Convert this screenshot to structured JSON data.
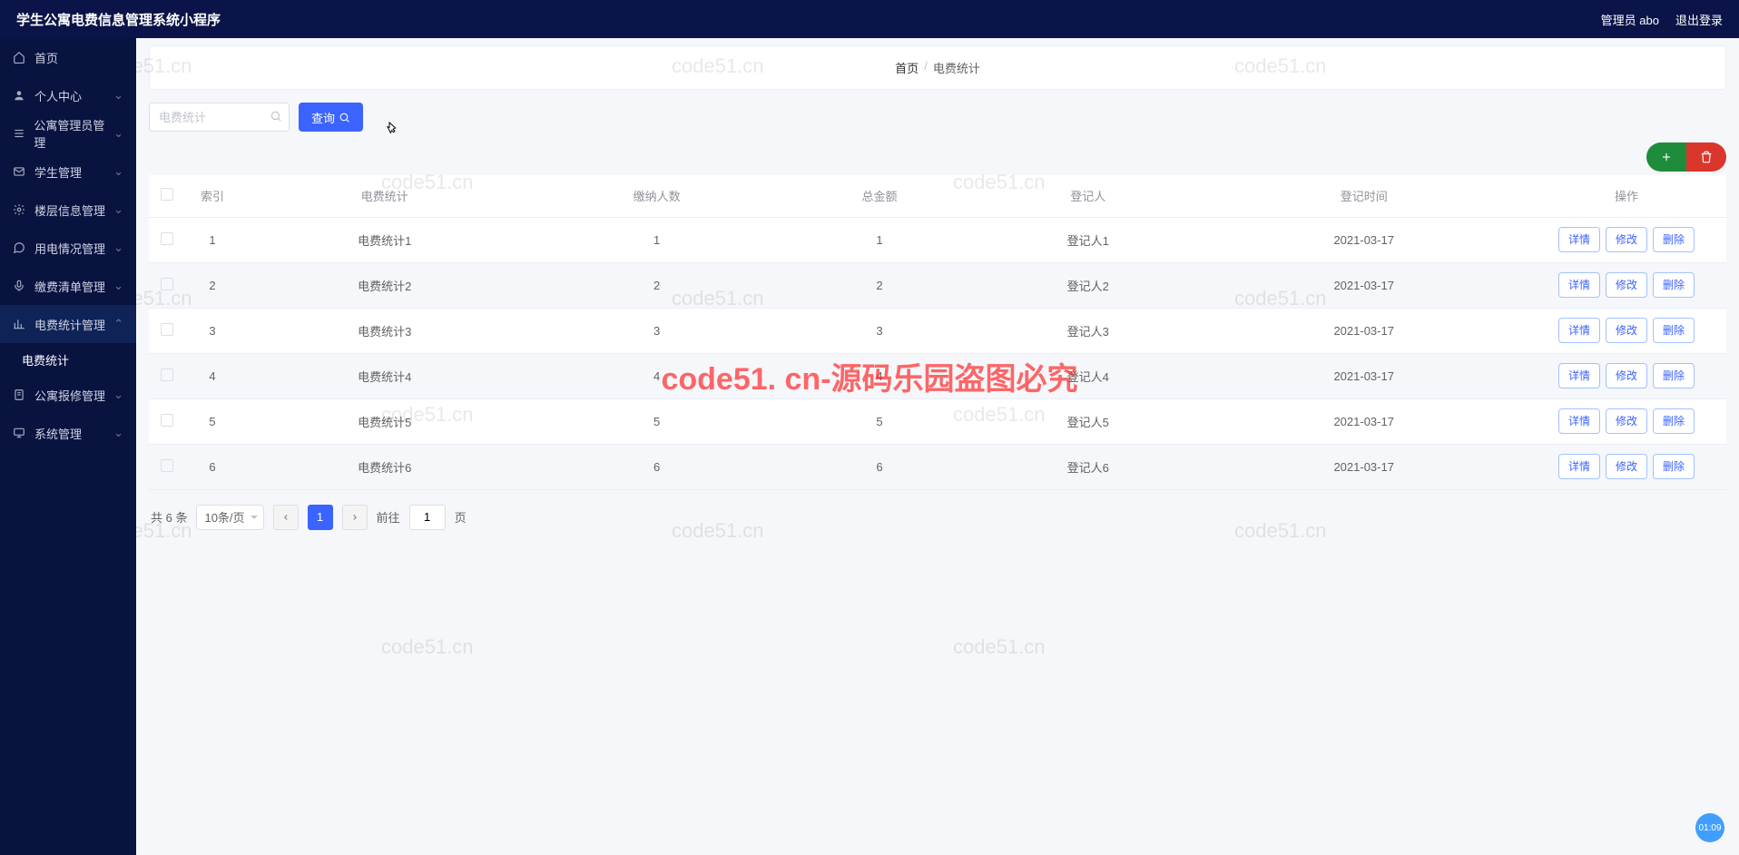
{
  "header": {
    "app_title": "学生公寓电费信息管理系统小程序",
    "admin_label": "管理员 abo",
    "logout_label": "退出登录"
  },
  "sidebar": {
    "items": [
      {
        "label": "首页",
        "icon": "home"
      },
      {
        "label": "个人中心",
        "icon": "user"
      },
      {
        "label": "公寓管理员管理",
        "icon": "list"
      },
      {
        "label": "学生管理",
        "icon": "mail"
      },
      {
        "label": "楼层信息管理",
        "icon": "gear"
      },
      {
        "label": "用电情况管理",
        "icon": "chat"
      },
      {
        "label": "缴费清单管理",
        "icon": "mic"
      },
      {
        "label": "电费统计管理",
        "icon": "chart"
      },
      {
        "label": "公寓报修管理",
        "icon": "doc"
      },
      {
        "label": "系统管理",
        "icon": "monitor"
      }
    ],
    "submenu_label": "电费统计"
  },
  "breadcrumb": {
    "home": "首页",
    "current": "电费统计"
  },
  "search": {
    "placeholder": "电费统计",
    "button_label": "查询"
  },
  "table": {
    "columns": [
      "索引",
      "电费统计",
      "缴纳人数",
      "总金额",
      "登记人",
      "登记时间",
      "操作"
    ],
    "rows": [
      {
        "idx": "1",
        "stat": "电费统计1",
        "count": "1",
        "amount": "1",
        "reg": "登记人1",
        "time": "2021-03-17"
      },
      {
        "idx": "2",
        "stat": "电费统计2",
        "count": "2",
        "amount": "2",
        "reg": "登记人2",
        "time": "2021-03-17"
      },
      {
        "idx": "3",
        "stat": "电费统计3",
        "count": "3",
        "amount": "3",
        "reg": "登记人3",
        "time": "2021-03-17"
      },
      {
        "idx": "4",
        "stat": "电费统计4",
        "count": "4",
        "amount": "4",
        "reg": "登记人4",
        "time": "2021-03-17"
      },
      {
        "idx": "5",
        "stat": "电费统计5",
        "count": "5",
        "amount": "5",
        "reg": "登记人5",
        "time": "2021-03-17"
      },
      {
        "idx": "6",
        "stat": "电费统计6",
        "count": "6",
        "amount": "6",
        "reg": "登记人6",
        "time": "2021-03-17"
      }
    ],
    "action_labels": {
      "detail": "详情",
      "edit": "修改",
      "delete": "删除"
    }
  },
  "pagination": {
    "total_label": "共 6 条",
    "page_size": "10条/页",
    "current_page": "1",
    "goto_prefix": "前往",
    "goto_value": "1",
    "goto_suffix": "页"
  },
  "watermarks": {
    "text": "code51.cn",
    "red_text": "code51. cn-源码乐园盗图必究"
  },
  "badge_time": "01:09"
}
